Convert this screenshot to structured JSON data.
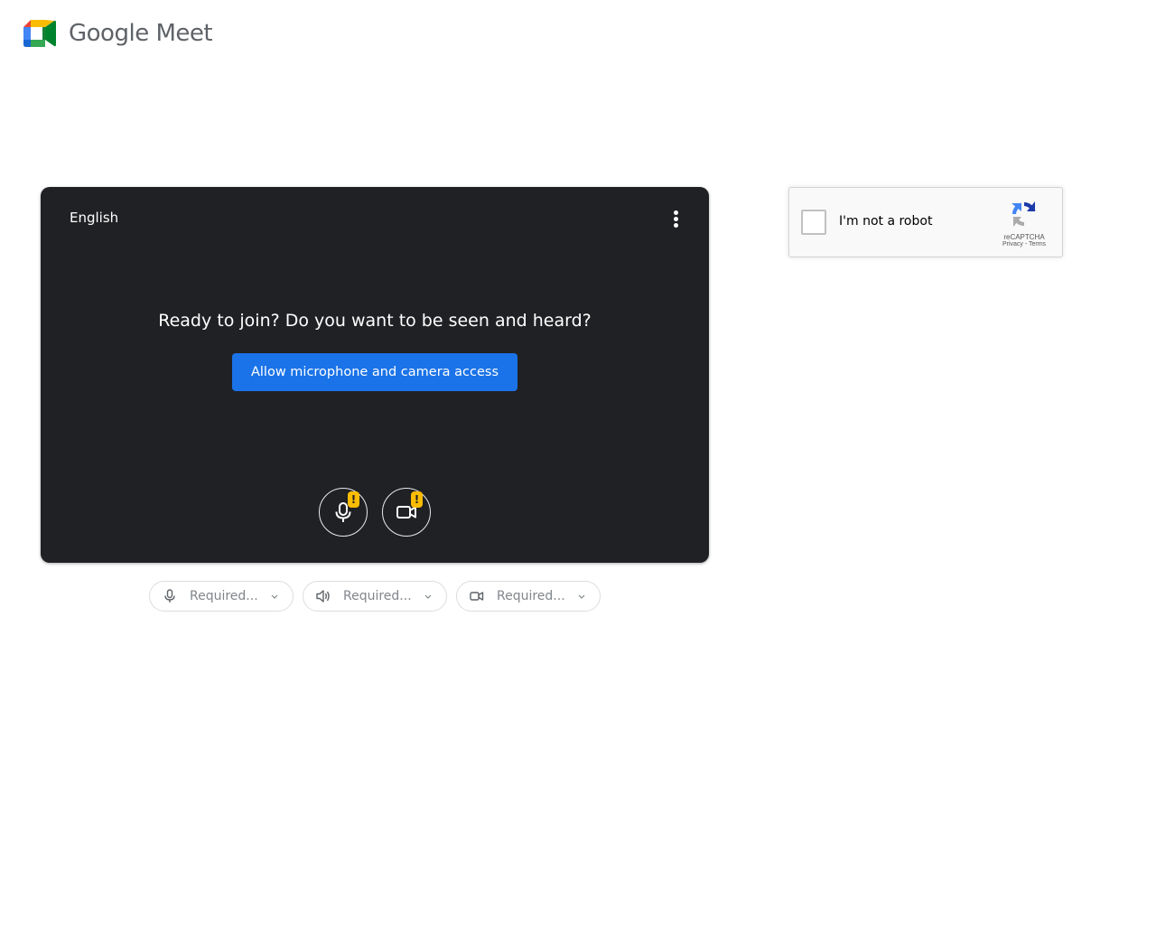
{
  "header": {
    "logo_text": "Google Meet"
  },
  "preview": {
    "language": "English",
    "prompt": "Ready to join? Do you want to be seen and heard?",
    "allow_button": "Allow microphone and camera access",
    "mic_warning": "!",
    "cam_warning": "!"
  },
  "devices": {
    "microphone": {
      "value": "Required...",
      "icon": "microphone-icon"
    },
    "speaker": {
      "value": "Required...",
      "icon": "speaker-icon"
    },
    "camera": {
      "value": "Required...",
      "icon": "camera-icon"
    }
  },
  "recaptcha": {
    "label": "I'm not a robot",
    "brand": "reCAPTCHA",
    "links": "Privacy - Terms"
  },
  "colors": {
    "accent": "#1a73e8",
    "preview_bg": "#202124",
    "warning": "#fbbc04"
  }
}
